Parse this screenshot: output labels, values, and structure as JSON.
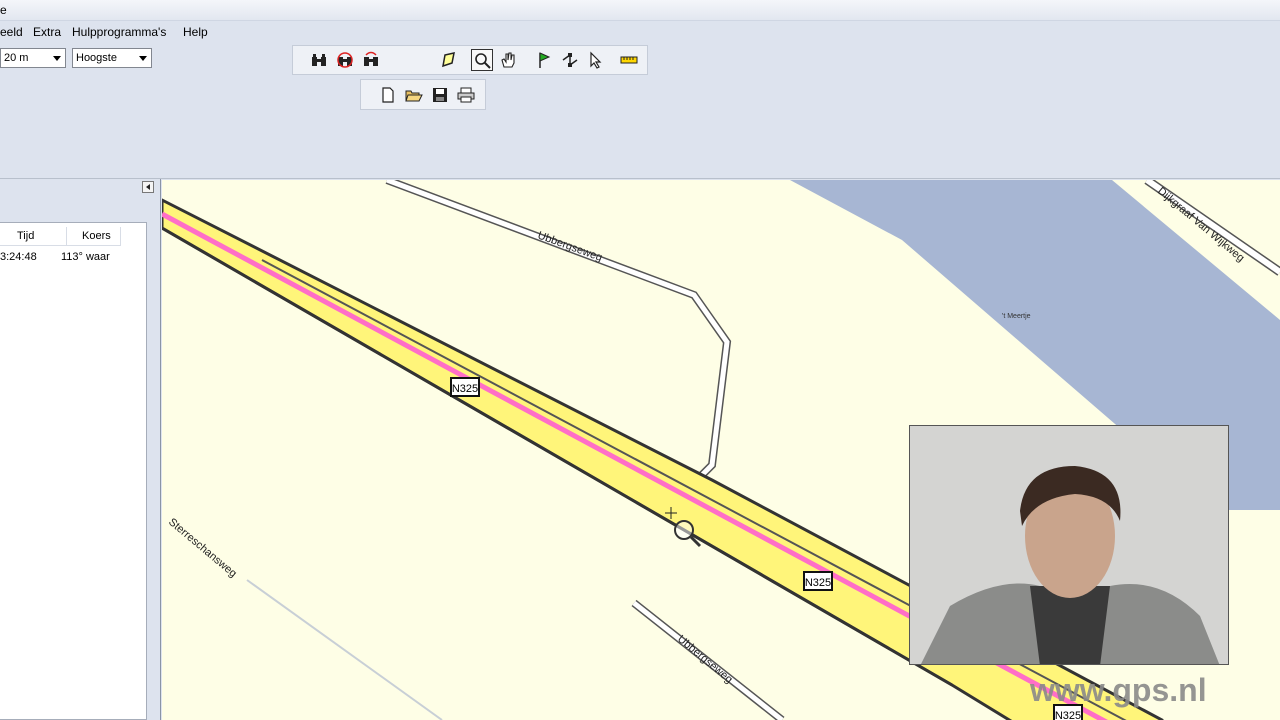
{
  "titlebar": {
    "text": "e"
  },
  "menu": {
    "items": [
      "eeld",
      "Extra",
      "Hulpprogramma's",
      "Help"
    ]
  },
  "toolbar": {
    "scale_value": "20 m",
    "detail_value": "Hoogste"
  },
  "route_panel": {
    "columns": [
      "Tijd",
      "Koers"
    ],
    "rows": [
      {
        "time": "3:24:48",
        "heading": "113° waar"
      }
    ]
  },
  "map": {
    "labels": {
      "road_top": "Ubbergseweg",
      "road_bottom": "Ubbergseweg",
      "dijk": "Dijkgraaf Van Wijkweg",
      "sterre": "Sterreschansweg",
      "water": "'t Meertje"
    },
    "shields": [
      "N325",
      "N325",
      "N325"
    ],
    "colors": {
      "land": "#fefee6",
      "water": "#a7b6d3",
      "highway_fill": "#fff57a",
      "highway_center": "#ff6ec7",
      "road_edge": "#555555"
    }
  },
  "watermark": "www.gps.nl"
}
